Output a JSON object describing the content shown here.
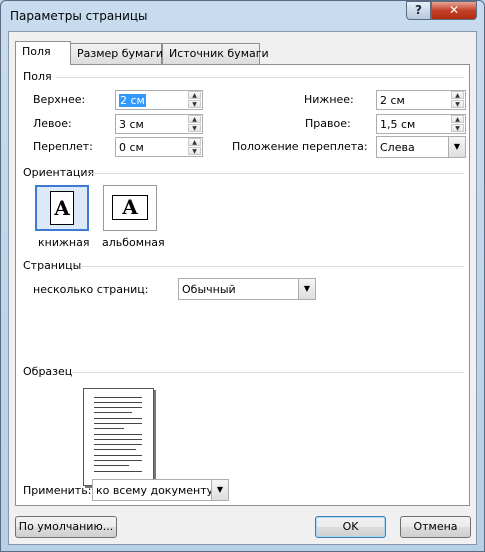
{
  "window": {
    "title": "Параметры страницы",
    "help_glyph": "?",
    "close_glyph": "✕"
  },
  "tabs": [
    {
      "label": "Поля",
      "active": true
    },
    {
      "label": "Размер бумаги",
      "active": false
    },
    {
      "label": "Источник бумаги",
      "active": false
    }
  ],
  "margins": {
    "group_label": "Поля",
    "top": {
      "label": "Верхнее:",
      "value": "2 см"
    },
    "bottom": {
      "label": "Нижнее:",
      "value": "2 см"
    },
    "left": {
      "label": "Левое:",
      "value": "3 см"
    },
    "right": {
      "label": "Правое:",
      "value": "1,5 см"
    },
    "gutter": {
      "label": "Переплет:",
      "value": "0 см"
    },
    "gutter_position": {
      "label": "Положение переплета:",
      "value": "Слева"
    }
  },
  "orientation": {
    "group_label": "Ориентация",
    "portrait": {
      "label": "книжная",
      "glyph": "A",
      "selected": true,
      "icon": "portrait-page-icon"
    },
    "landscape": {
      "label": "альбомная",
      "glyph": "A",
      "selected": false,
      "icon": "landscape-page-icon"
    }
  },
  "pages": {
    "group_label": "Страницы",
    "multiple_label": "несколько страниц:",
    "multiple_value": "Обычный"
  },
  "preview": {
    "group_label": "Образец"
  },
  "apply": {
    "label": "Применить:",
    "value": "ко всему документу"
  },
  "buttons": {
    "default": "По умолчанию...",
    "ok": "OK",
    "cancel": "Отмена"
  },
  "colors": {
    "selection": "#3399ff",
    "close": "#c4412a",
    "accent": "#3d7bd3"
  }
}
